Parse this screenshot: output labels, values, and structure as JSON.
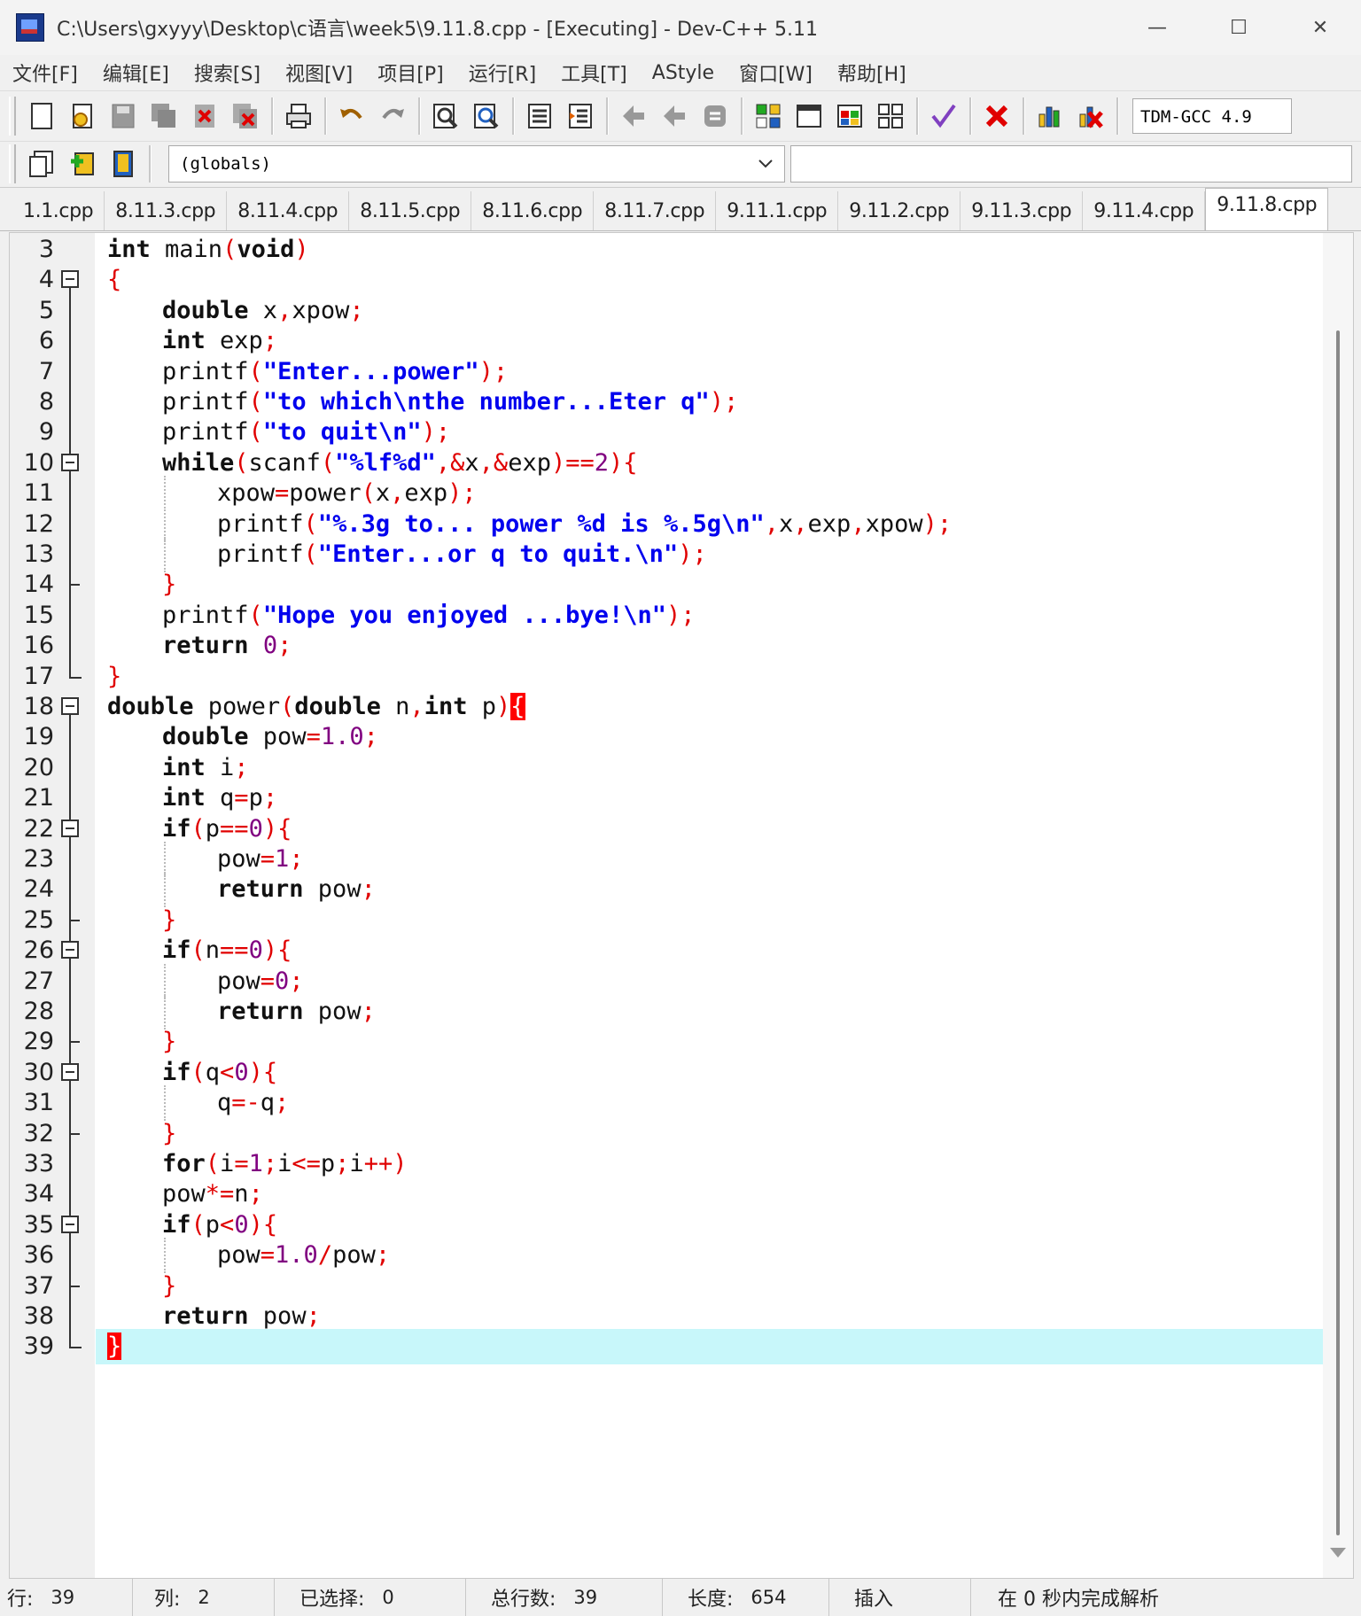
{
  "window": {
    "title": "C:\\Users\\gxyyy\\Desktop\\c语言\\week5\\9.11.8.cpp - [Executing] - Dev-C++ 5.11",
    "minimize": "—",
    "maximize": "☐",
    "close": "✕"
  },
  "menu": [
    "文件[F]",
    "编辑[E]",
    "搜索[S]",
    "视图[V]",
    "项目[P]",
    "运行[R]",
    "工具[T]",
    "AStyle",
    "窗口[W]",
    "帮助[H]"
  ],
  "toolbar": {
    "compiler": "TDM-GCC 4.9",
    "scope": "(globals)",
    "colors": {
      "red": "#e00000",
      "blue": "#0000ee",
      "green": "#22aa22",
      "yellow": "#f0c020"
    }
  },
  "tabs": [
    "1.1.cpp",
    "8.11.3.cpp",
    "8.11.4.cpp",
    "8.11.5.cpp",
    "8.11.6.cpp",
    "8.11.7.cpp",
    "9.11.1.cpp",
    "9.11.2.cpp",
    "9.11.3.cpp",
    "9.11.4.cpp",
    "9.11.8.cpp"
  ],
  "active_tab": "9.11.8.cpp",
  "editor": {
    "line_numbers": [
      "3",
      "4",
      "5",
      "6",
      "7",
      "8",
      "9",
      "10",
      "11",
      "12",
      "13",
      "14",
      "15",
      "16",
      "17",
      "18",
      "19",
      "20",
      "21",
      "22",
      "23",
      "24",
      "25",
      "26",
      "27",
      "28",
      "29",
      "30",
      "31",
      "32",
      "33",
      "34",
      "35",
      "36",
      "37",
      "38",
      "39"
    ],
    "current_line": "39"
  },
  "status": {
    "row_label": "行:",
    "row_value": "39",
    "col_label": "列:",
    "col_value": "2",
    "sel_label": "已选择:",
    "sel_value": "0",
    "lines_label": "总行数:",
    "lines_value": "39",
    "len_label": "长度:",
    "len_value": "654",
    "mode": "插入",
    "parse": "在 0 秒内完成解析"
  }
}
